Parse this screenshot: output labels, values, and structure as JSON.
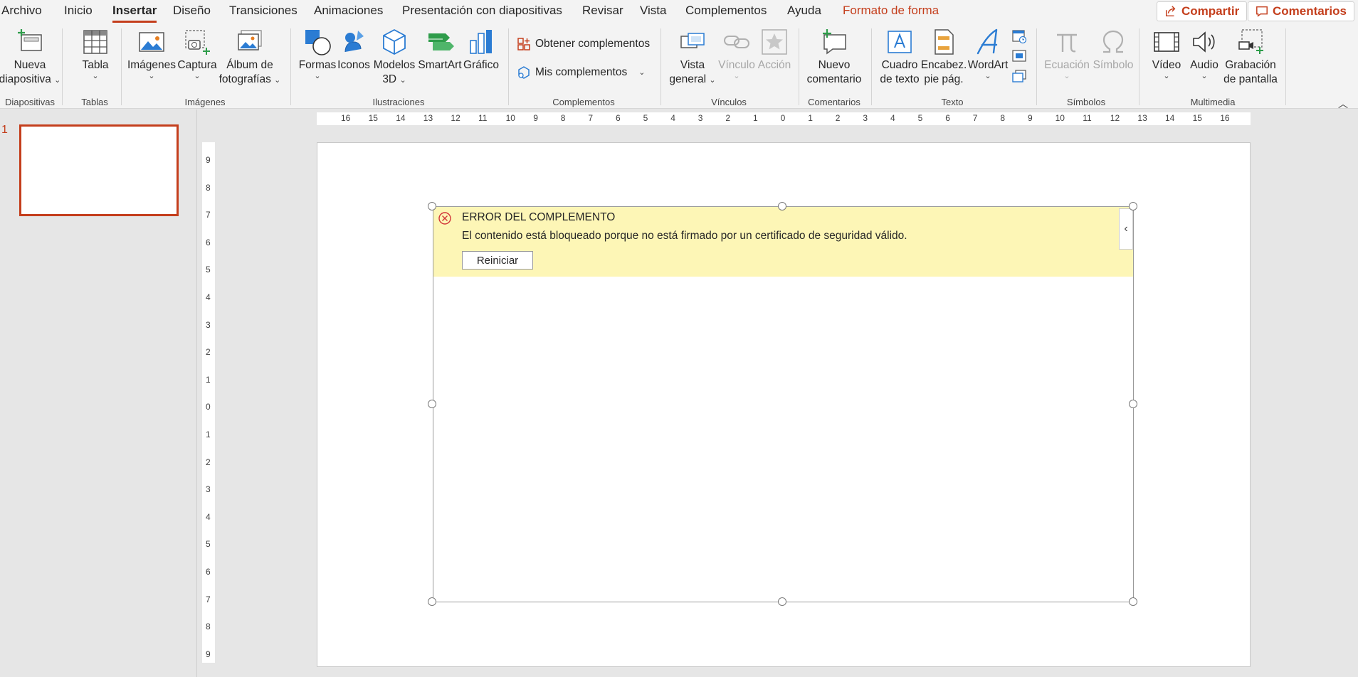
{
  "menu": {
    "items": [
      "Archivo",
      "Inicio",
      "Insertar",
      "Diseño",
      "Transiciones",
      "Animaciones",
      "Presentación con diapositivas",
      "Revisar",
      "Vista",
      "Complementos",
      "Ayuda",
      "Formato de forma"
    ],
    "active": "Insertar",
    "share_label": "Compartir",
    "comments_label": "Comentarios"
  },
  "ribbon": {
    "groups": {
      "diapositivas": "Diapositivas",
      "tablas": "Tablas",
      "imagenes": "Imágenes",
      "ilustraciones": "Ilustraciones",
      "complementos": "Complementos",
      "vinculos": "Vínculos",
      "comentarios": "Comentarios",
      "texto": "Texto",
      "simbolos": "Símbolos",
      "multimedia": "Multimedia"
    },
    "buttons": {
      "nueva_1": "Nueva",
      "nueva_2": "diapositiva",
      "tabla": "Tabla",
      "imagenes": "Imágenes",
      "captura": "Captura",
      "album_1": "Álbum de",
      "album_2": "fotografías",
      "formas": "Formas",
      "iconos": "Iconos",
      "modelos_1": "Modelos",
      "modelos_2": "3D",
      "smartart": "SmartArt",
      "grafico": "Gráfico",
      "obtener": "Obtener complementos",
      "mis": "Mis complementos",
      "vista_1": "Vista",
      "vista_2": "general",
      "vinculo": "Vínculo",
      "accion": "Acción",
      "nuevo_com_1": "Nuevo",
      "nuevo_com_2": "comentario",
      "cuadro_1": "Cuadro",
      "cuadro_2": "de texto",
      "encab_1": "Encabez.",
      "encab_2": "pie pág.",
      "wordart": "WordArt",
      "ecuacion": "Ecuación",
      "simbolo": "Símbolo",
      "video": "Vídeo",
      "audio": "Audio",
      "grab_1": "Grabación",
      "grab_2": "de pantalla"
    }
  },
  "thumbnails": {
    "slide_number": "1"
  },
  "rulers": {
    "horizontal": [
      "16",
      "15",
      "14",
      "13",
      "12",
      "11",
      "10",
      "9",
      "8",
      "7",
      "6",
      "5",
      "4",
      "3",
      "2",
      "1",
      "0",
      "1",
      "2",
      "3",
      "4",
      "5",
      "6",
      "7",
      "8",
      "9",
      "10",
      "11",
      "12",
      "13",
      "14",
      "15",
      "16"
    ],
    "vertical": [
      "9",
      "8",
      "7",
      "6",
      "5",
      "4",
      "3",
      "2",
      "1",
      "0",
      "1",
      "2",
      "3",
      "4",
      "5",
      "6",
      "7",
      "8",
      "9"
    ]
  },
  "addin_error": {
    "title": "ERROR DEL COMPLEMENTO",
    "message": "El contenido está bloqueado porque no está firmado por un certificado de seguridad válido.",
    "button_label": "Reiniciar",
    "toggle_glyph": "‹"
  },
  "colors": {
    "accent": "#c43e1c",
    "error_bar": "#fdf6b6",
    "error_icon": "#d13438"
  }
}
